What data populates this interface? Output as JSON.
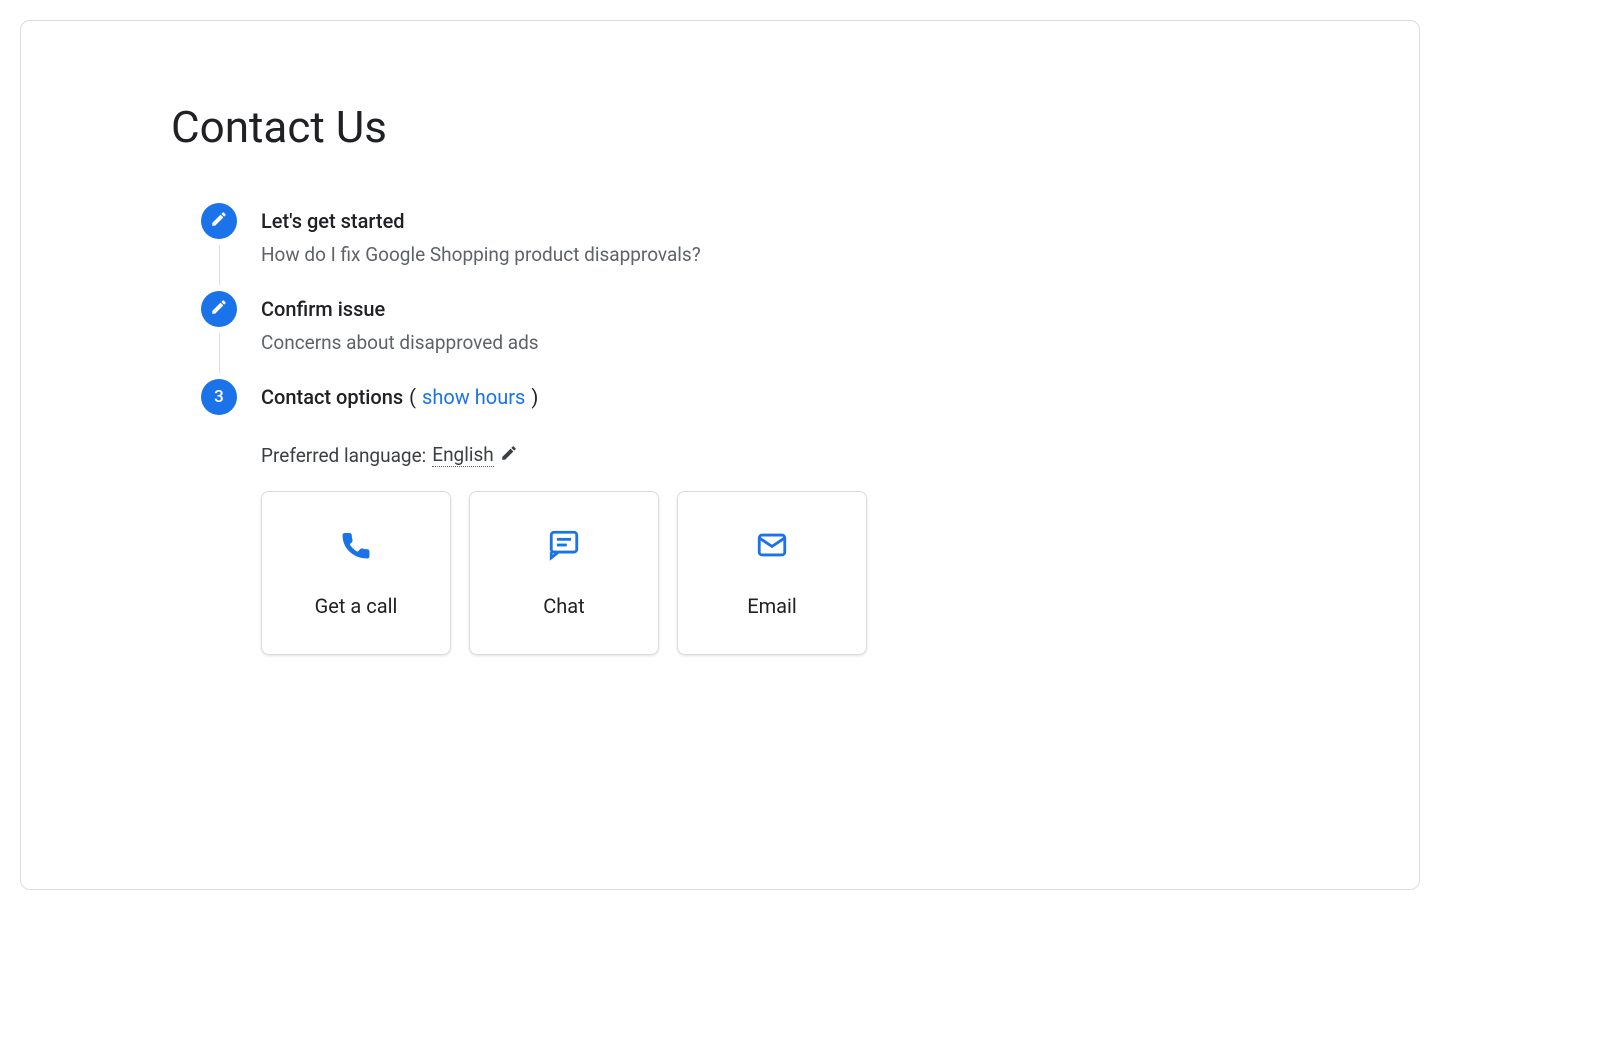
{
  "page": {
    "title": "Contact Us"
  },
  "steps": [
    {
      "title": "Let's get started",
      "subtitle": "How do I fix Google Shopping product disapprovals?"
    },
    {
      "title": "Confirm issue",
      "subtitle": "Concerns about disapproved ads"
    },
    {
      "number": "3",
      "title": "Contact options",
      "show_hours_link": "show hours",
      "open_paren": "(",
      "close_paren": ")"
    }
  ],
  "language": {
    "label": "Preferred language:",
    "value": "English"
  },
  "contact_options": [
    {
      "label": "Get a call"
    },
    {
      "label": "Chat"
    },
    {
      "label": "Email"
    }
  ]
}
